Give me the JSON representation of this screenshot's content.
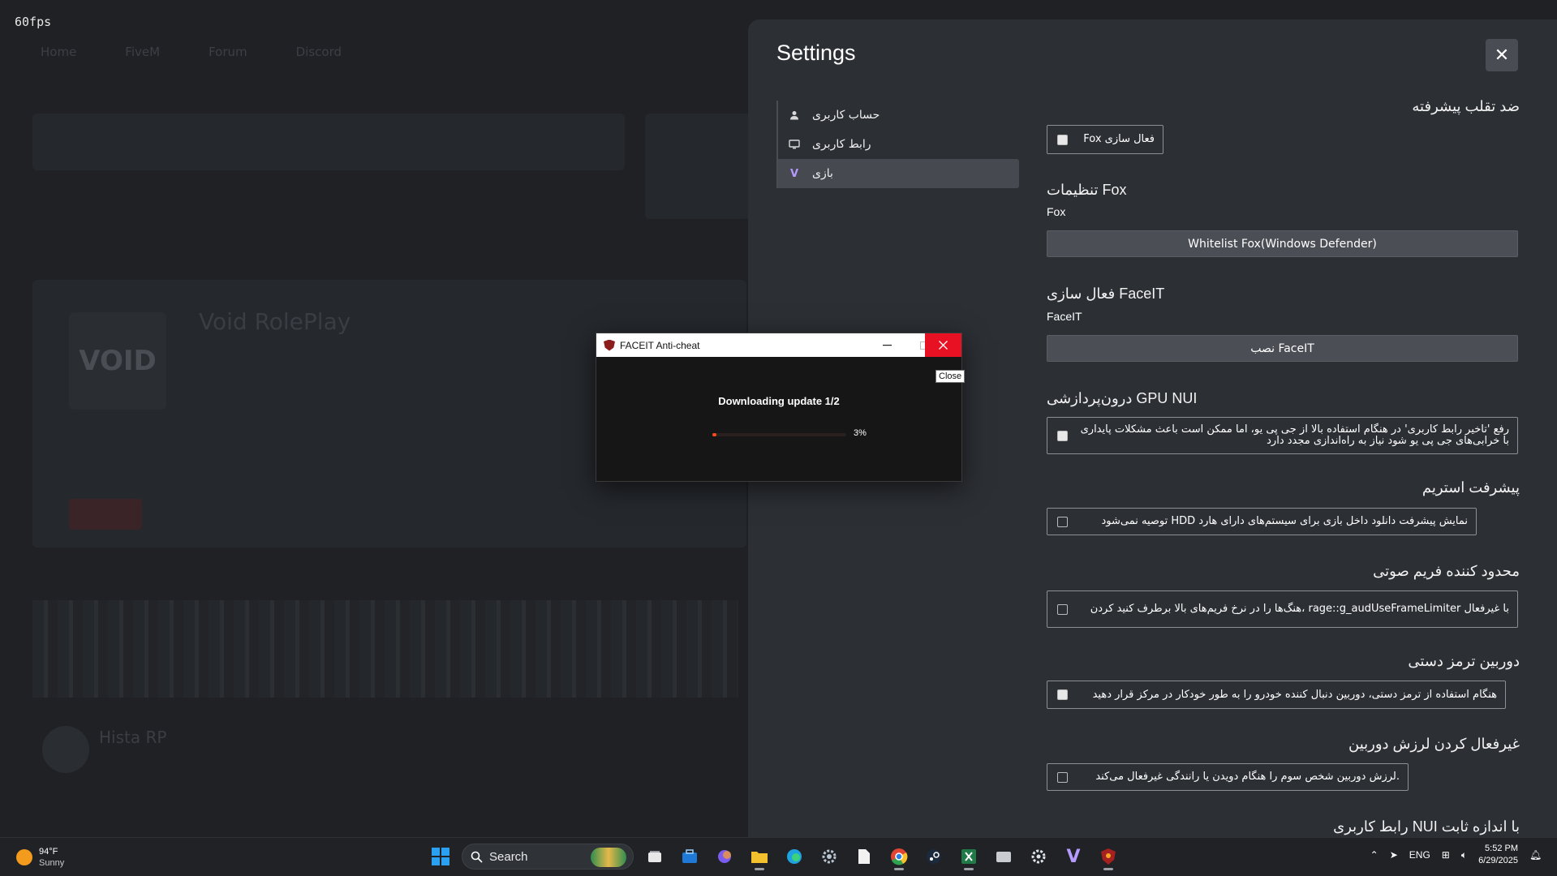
{
  "fps": "60fps",
  "background": {
    "nav": [
      "Home",
      "FiveM",
      "Forum",
      "Discord"
    ],
    "server_title": "Void RolePlay",
    "server_title2": "Hista RP",
    "logo_text": "VOID"
  },
  "settings": {
    "title": "Settings",
    "close_label": "✕",
    "nav": [
      {
        "label": "حساب کاربری",
        "icon": "user-icon"
      },
      {
        "label": "رابط کاربری",
        "icon": "monitor-icon"
      },
      {
        "label": "بازی",
        "icon": "v-icon"
      }
    ],
    "anticheat": {
      "heading": "ضد تقلب پیشرفته",
      "checkbox_label": "فعال سازی Fox",
      "checked": true
    },
    "fox": {
      "heading": "تنظیمات Fox",
      "sub": "Fox",
      "button": "Whitelist Fox(Windows Defender)"
    },
    "faceit": {
      "heading": "فعال سازی FaceIT",
      "sub": "FaceIT",
      "button": "نصب FaceIT"
    },
    "gpu": {
      "heading": "درون‌پردازشی GPU NUI",
      "checkbox_label": "رفع 'تاخیر رابط کاربری' در هنگام استفاده بالا از جی پی یو، اما ممکن است باعث مشکلات پایداری با خرابی‌های جی پی یو شود نیاز به راه‌اندازی مجدد دارد",
      "checked": true
    },
    "stream": {
      "heading": "پیشرفت استریم",
      "checkbox_label": "نمایش پیشرفت دانلود داخل بازی برای سیستم‌های دارای هارد HDD توصیه نمی‌شود",
      "checked": false
    },
    "audio": {
      "heading": "محدود کننده فریم صوتی",
      "checkbox_label": "با غیرفعال rage::g_audUseFrameLimiter ،هنگ‌ها را در نرخ فریم‌های بالا برطرف کنید کردن",
      "checked": false
    },
    "handbrake": {
      "heading": "دوربین ترمز دستی",
      "checkbox_label": "هنگام استفاده از ترمز دستی، دوربین دنبال کننده خودرو را به طور خودکار در مرکز قرار دهید",
      "checked": true
    },
    "shake": {
      "heading": "غیرفعال کردن لرزش دوربین",
      "checkbox_label": ".لرزش دوربین شخص سوم را هنگام دویدن یا رانندگی غیرفعال می‌کند",
      "checked": false
    },
    "fixed_nui": {
      "heading": "با اندازه ثابت NUI رابط کاربری"
    }
  },
  "faceit_dialog": {
    "title": "FACEIT Anti-cheat",
    "message": "Downloading update 1/2",
    "progress": 0.03,
    "progress_label": "3%",
    "tooltip": "Close"
  },
  "taskbar": {
    "weather_temp": "94°F",
    "weather_cond": "Sunny",
    "search_placeholder": "Search",
    "lang": "ENG",
    "time": "5:52 PM",
    "date": "6/29/2025",
    "accent": "#2aa0f0"
  }
}
